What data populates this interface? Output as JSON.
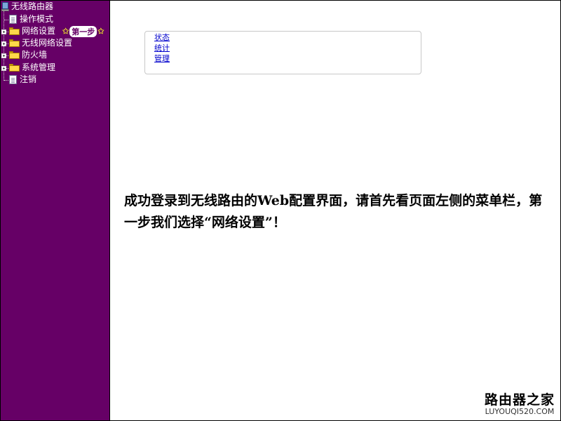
{
  "sidebar": {
    "background_color": "#660066",
    "root": {
      "label": "无线路由器",
      "icon": "router-computer-icon"
    },
    "items": [
      {
        "label": "操作模式",
        "type": "page",
        "icon": "page-icon"
      },
      {
        "label": "网络设置",
        "type": "folder",
        "icon": "folder-icon"
      },
      {
        "label": "无线网络设置",
        "type": "folder",
        "icon": "folder-icon"
      },
      {
        "label": "防火墙",
        "type": "folder",
        "icon": "folder-icon"
      },
      {
        "label": "系统管理",
        "type": "folder",
        "icon": "folder-icon"
      },
      {
        "label": "注销",
        "type": "page",
        "icon": "page-icon"
      }
    ],
    "annotation": {
      "star": "✩",
      "text": "第一步"
    }
  },
  "panel": {
    "links": [
      "状态",
      "统计",
      "管理"
    ],
    "link_color": "#0000cc"
  },
  "caption": {
    "text": "成功登录到无线路由的Web配置界面，请首先看页面左侧的菜单栏，第一步我们选择“网络设置”！"
  },
  "watermark": {
    "main": "路由器之家",
    "sub": "LUYOUQI520.COM"
  }
}
